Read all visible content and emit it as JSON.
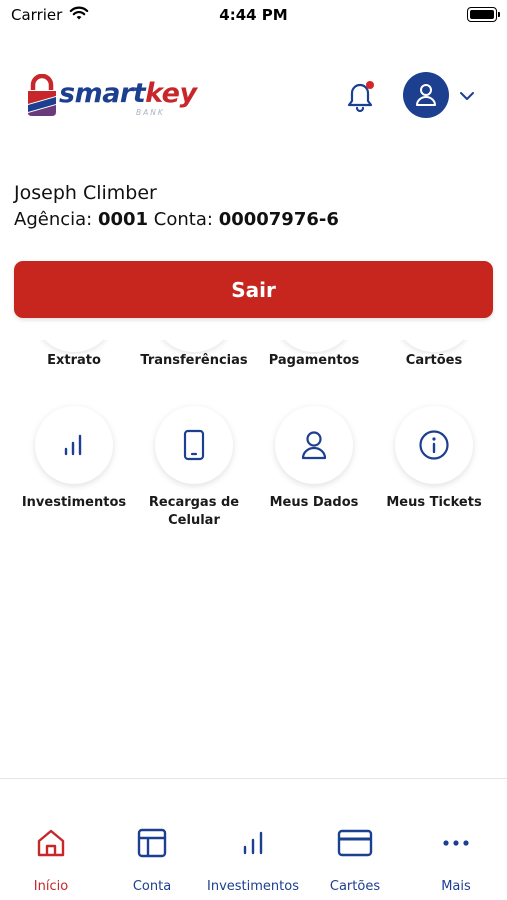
{
  "status_bar": {
    "carrier": "Carrier",
    "time": "4:44 PM"
  },
  "header": {
    "logo_smart": "smart",
    "logo_key": "key",
    "logo_bank": "BANK",
    "has_notification": true
  },
  "user": {
    "name": "Joseph Climber",
    "agency_label": "Agência:",
    "agency_number": "0001",
    "account_label": "Conta:",
    "account_number": "00007976-6"
  },
  "logout_label": "Sair",
  "actions_row1": [
    {
      "label": "Extrato"
    },
    {
      "label": "Transferências"
    },
    {
      "label": "Pagamentos"
    },
    {
      "label": "Cartões"
    }
  ],
  "actions_row2": [
    {
      "label": "Investimentos",
      "icon": "bar-chart-icon"
    },
    {
      "label": "Recargas de Celular",
      "icon": "phone-icon"
    },
    {
      "label": "Meus Dados",
      "icon": "user-icon"
    },
    {
      "label": "Meus Tickets",
      "icon": "info-icon"
    }
  ],
  "bottom_nav": [
    {
      "label": "Início",
      "icon": "home-icon",
      "active": true
    },
    {
      "label": "Conta",
      "icon": "layout-icon",
      "active": false
    },
    {
      "label": "Investimentos",
      "icon": "bar-chart-icon",
      "active": false
    },
    {
      "label": "Cartões",
      "icon": "card-icon",
      "active": false
    },
    {
      "label": "Mais",
      "icon": "more-icon",
      "active": false
    }
  ],
  "colors": {
    "brand_blue": "#1d3f8f",
    "brand_red": "#c7262a",
    "button_red": "#c7261e"
  }
}
